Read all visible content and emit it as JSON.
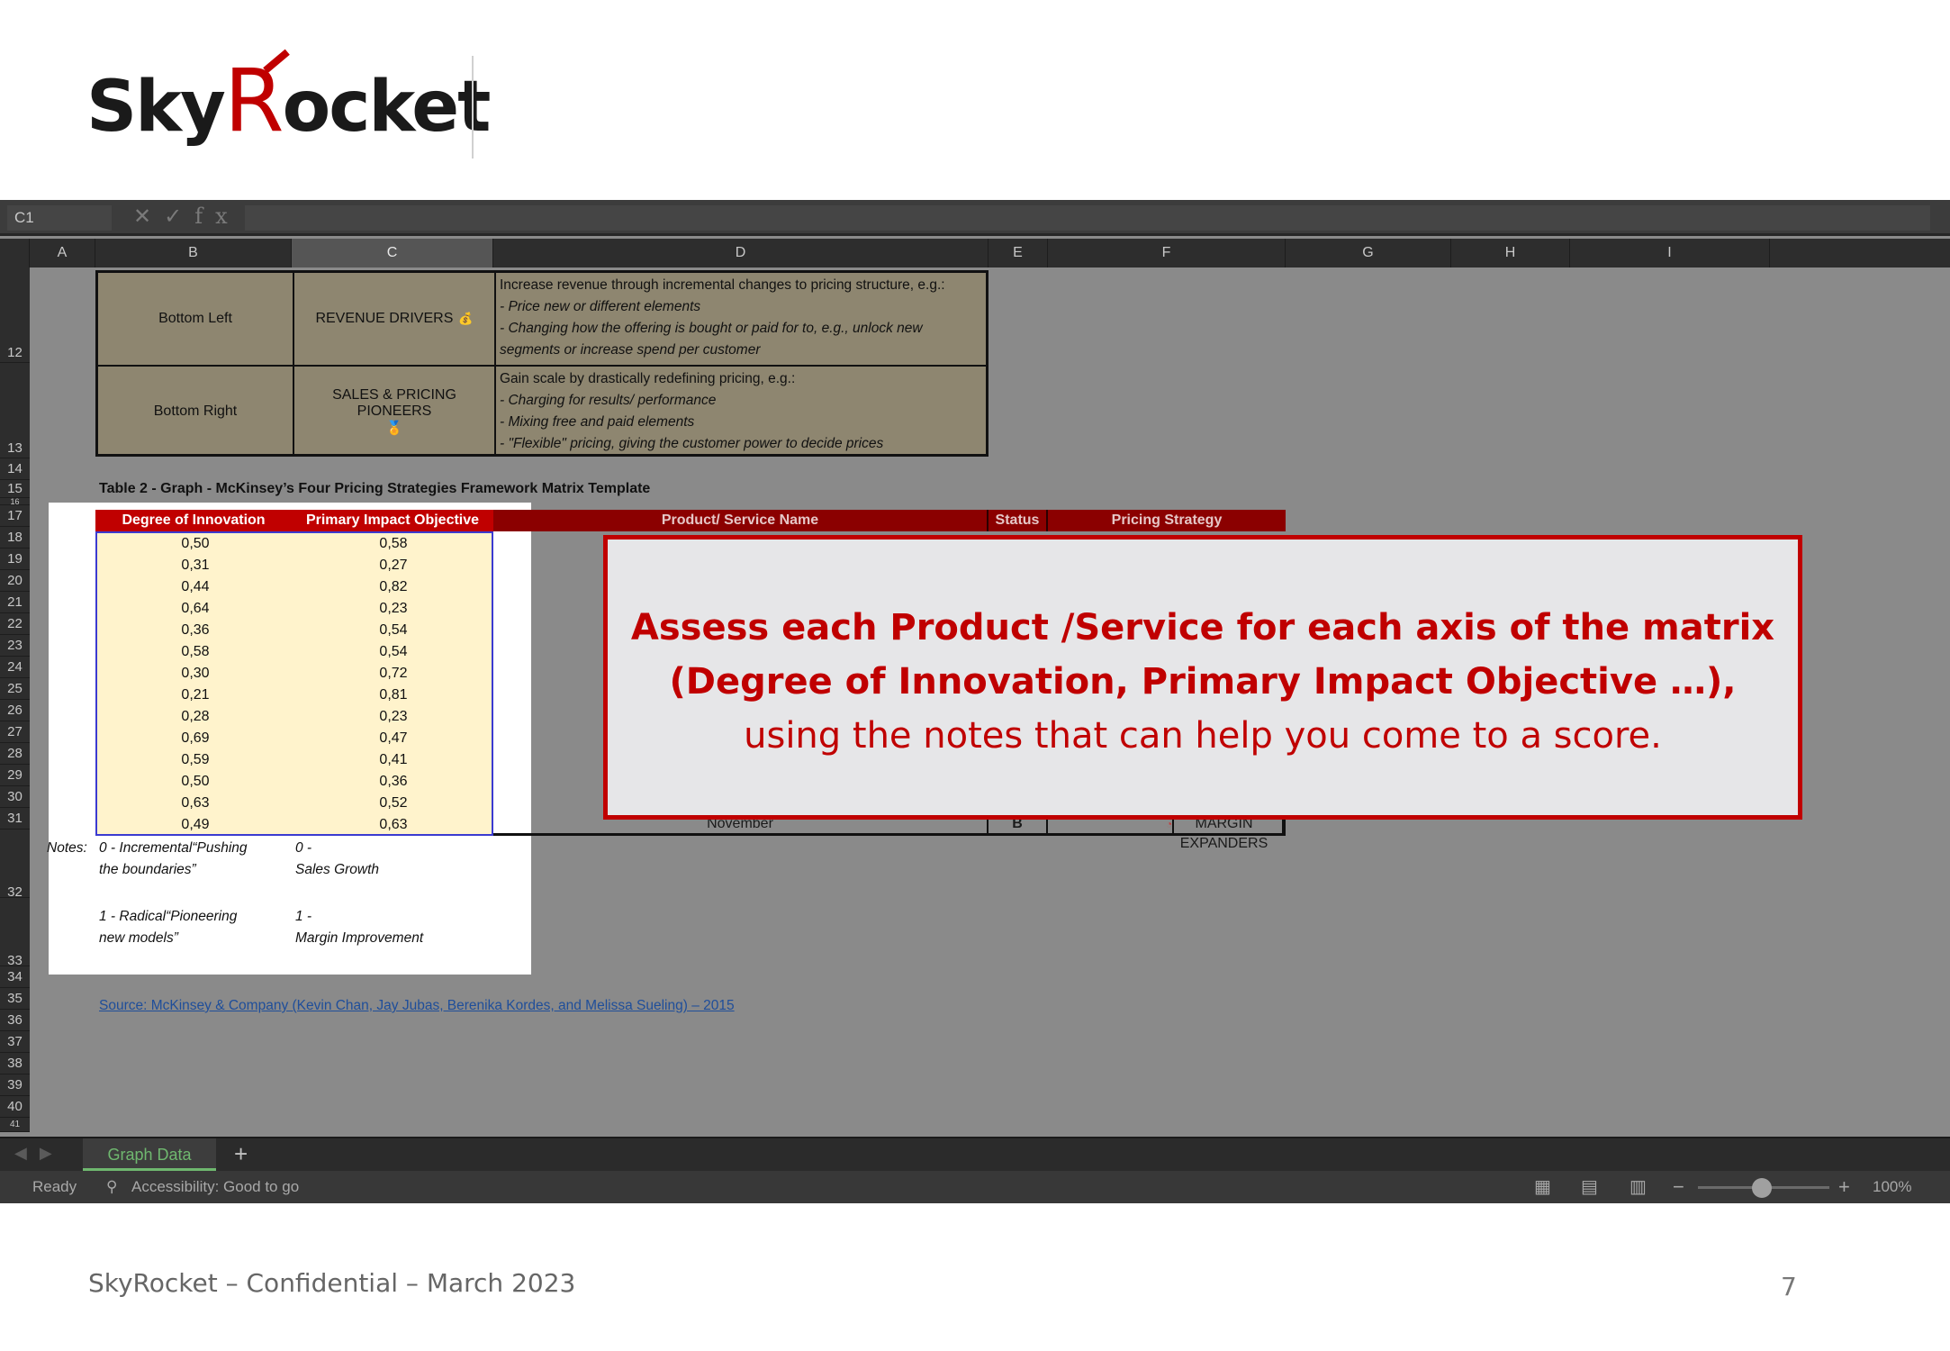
{
  "brand": {
    "logo_pre": "Sky",
    "logo_r": "R",
    "logo_post": "ocket"
  },
  "excel": {
    "name_box": "C1",
    "columns": [
      "A",
      "B",
      "C",
      "D",
      "E",
      "F",
      "G",
      "H",
      "I"
    ],
    "rows": [
      "12",
      "13",
      "14",
      "15",
      "16",
      "17",
      "18",
      "19",
      "20",
      "21",
      "22",
      "23",
      "24",
      "25",
      "26",
      "27",
      "28",
      "29",
      "30",
      "31",
      "32",
      "33",
      "34",
      "35",
      "36",
      "37",
      "38",
      "39",
      "40",
      "41"
    ],
    "table1": [
      {
        "position": "Bottom Left",
        "name": "REVENUE DRIVERS",
        "icon": "money-bag-icon",
        "lines": [
          "Increase revenue through incremental changes to pricing structure, e.g.:",
          "- Price new or different elements",
          "- Changing how the offering is bought or paid for to, e.g., unlock new",
          "segments or increase spend per customer"
        ]
      },
      {
        "position": "Bottom Right",
        "name": "SALES & PRICING PIONEERS",
        "icon": "medal-icon",
        "lines": [
          "Gain scale by drastically redefining pricing, e.g.:",
          "- Charging for results/ performance",
          "- Mixing free and paid elements",
          "- \"Flexible\" pricing, giving the customer power to decide prices"
        ]
      }
    ],
    "caption": "Table 2 - Graph - McKinsey’s Four Pricing Strategies Framework Matrix Template",
    "data_headers": [
      "Degree of Innovation",
      "Primary Impact Objective"
    ],
    "data_rows": [
      [
        "0,50",
        "0,58"
      ],
      [
        "0,31",
        "0,27"
      ],
      [
        "0,44",
        "0,82"
      ],
      [
        "0,64",
        "0,23"
      ],
      [
        "0,36",
        "0,54"
      ],
      [
        "0,58",
        "0,54"
      ],
      [
        "0,30",
        "0,72"
      ],
      [
        "0,21",
        "0,81"
      ],
      [
        "0,28",
        "0,23"
      ],
      [
        "0,69",
        "0,47"
      ],
      [
        "0,59",
        "0,41"
      ],
      [
        "0,50",
        "0,36"
      ],
      [
        "0,63",
        "0,52"
      ],
      [
        "0,49",
        "0,63"
      ]
    ],
    "right_headers": [
      "Product/ Service Name",
      "Status",
      "Pricing Strategy"
    ],
    "right_last_row": {
      "name": "November",
      "status": "B",
      "strategy": "MARGIN EXPANDERS"
    },
    "notes": {
      "label": "Notes:",
      "innovation_0": [
        "0 - Incremental“Pushing",
        "the boundaries”"
      ],
      "innovation_1": [
        "1 - Radical“Pioneering",
        "new models”"
      ],
      "impact_0": [
        "0 -",
        "Sales Growth"
      ],
      "impact_1": [
        "1 -",
        "Margin Improvement"
      ]
    },
    "source": "Source: McKinsey & Company (Kevin Chan, Jay Jubas, Berenika Kordes, and Melissa Sueling) – 2015",
    "sheet_tab": "Graph Data",
    "status_ready": "Ready",
    "accessibility": "Accessibility: Good to go",
    "zoom": "100%"
  },
  "callout": {
    "line1": "Assess each Product /Service for each axis of the matrix",
    "line2": "(Degree of Innovation, Primary Impact Objective …),",
    "line3": "using the notes that can help you come to a score."
  },
  "footer": {
    "text": "SkyRocket – Confidential – March 2023",
    "page": "7"
  },
  "colors": {
    "brand_red": "#c00000",
    "header_red": "#8b0000",
    "cell_yellow": "#fff3cc",
    "excel_dark": "#2d2d2d"
  }
}
